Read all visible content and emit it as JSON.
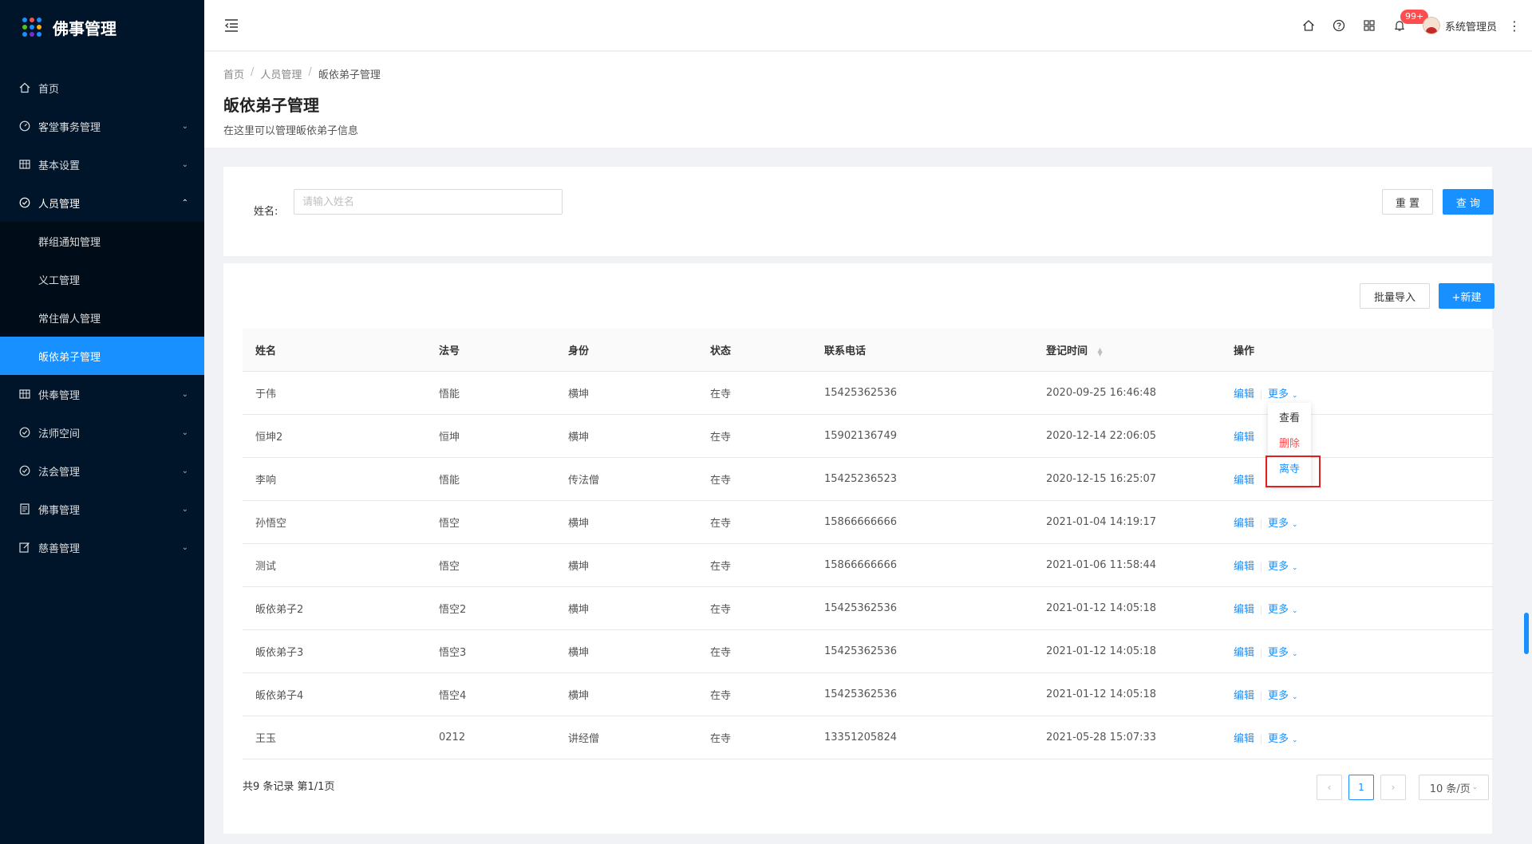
{
  "app": {
    "title": "佛事管理"
  },
  "sidebar": {
    "items": [
      {
        "label": "首页",
        "icon": "home-icon"
      },
      {
        "label": "客堂事务管理",
        "icon": "dashboard-icon"
      },
      {
        "label": "基本设置",
        "icon": "table-icon"
      },
      {
        "label": "人员管理",
        "icon": "check-circle-icon"
      },
      {
        "label": "供奉管理",
        "icon": "table-icon"
      },
      {
        "label": "法师空间",
        "icon": "check-circle-icon"
      },
      {
        "label": "法会管理",
        "icon": "check-circle-icon"
      },
      {
        "label": "佛事管理",
        "icon": "file-icon"
      },
      {
        "label": "慈善管理",
        "icon": "edit-icon"
      }
    ],
    "sub_items": [
      {
        "label": "群组通知管理"
      },
      {
        "label": "义工管理"
      },
      {
        "label": "常住僧人管理"
      },
      {
        "label": "皈依弟子管理"
      }
    ]
  },
  "header": {
    "badge": "99+",
    "user_name": "系统管理员"
  },
  "breadcrumb": [
    "首页",
    "人员管理",
    "皈依弟子管理"
  ],
  "page": {
    "title": "皈依弟子管理",
    "description": "在这里可以管理皈依弟子信息"
  },
  "search": {
    "label": "姓名:",
    "placeholder": "请输入姓名",
    "reset_label": "重 置",
    "query_label": "查 询"
  },
  "toolbar": {
    "import_label": "批量导入",
    "new_label": "+新建"
  },
  "table": {
    "columns": [
      "姓名",
      "法号",
      "身份",
      "状态",
      "联系电话",
      "登记时间",
      "操作"
    ],
    "rows": [
      [
        "于伟",
        "悟能",
        "横坤",
        "在寺",
        "15425362536",
        "2020-09-25 16:46:48"
      ],
      [
        "恒坤2",
        "恒坤",
        "横坤",
        "在寺",
        "15902136749",
        "2020-12-14 22:06:05"
      ],
      [
        "李响",
        "悟能",
        "传法僧",
        "在寺",
        "15425236523",
        "2020-12-15 16:25:07"
      ],
      [
        "孙悟空",
        "悟空",
        "横坤",
        "在寺",
        "15866666666",
        "2021-01-04 14:19:17"
      ],
      [
        "测试",
        "悟空",
        "横坤",
        "在寺",
        "15866666666",
        "2021-01-06 11:58:44"
      ],
      [
        "皈依弟子2",
        "悟空2",
        "横坤",
        "在寺",
        "15425362536",
        "2021-01-12 14:05:18"
      ],
      [
        "皈依弟子3",
        "悟空3",
        "横坤",
        "在寺",
        "15425362536",
        "2021-01-12 14:05:18"
      ],
      [
        "皈依弟子4",
        "悟空4",
        "横坤",
        "在寺",
        "15425362536",
        "2021-01-12 14:05:18"
      ],
      [
        "王玉",
        "0212",
        "讲经僧",
        "在寺",
        "13351205824",
        "2021-05-28 15:07:33"
      ]
    ],
    "edit_label": "编辑",
    "more_label": "更多"
  },
  "dropdown": {
    "view_label": "查看",
    "delete_label": "删除",
    "leave_label": "离寺"
  },
  "pagination": {
    "total_text": "共9 条记录 第1/1页",
    "current_page": "1",
    "page_size": "10 条/页"
  },
  "colors": {
    "sidebar_bg": "#001529",
    "primary": "#1890ff",
    "danger": "#ff4d4f"
  }
}
